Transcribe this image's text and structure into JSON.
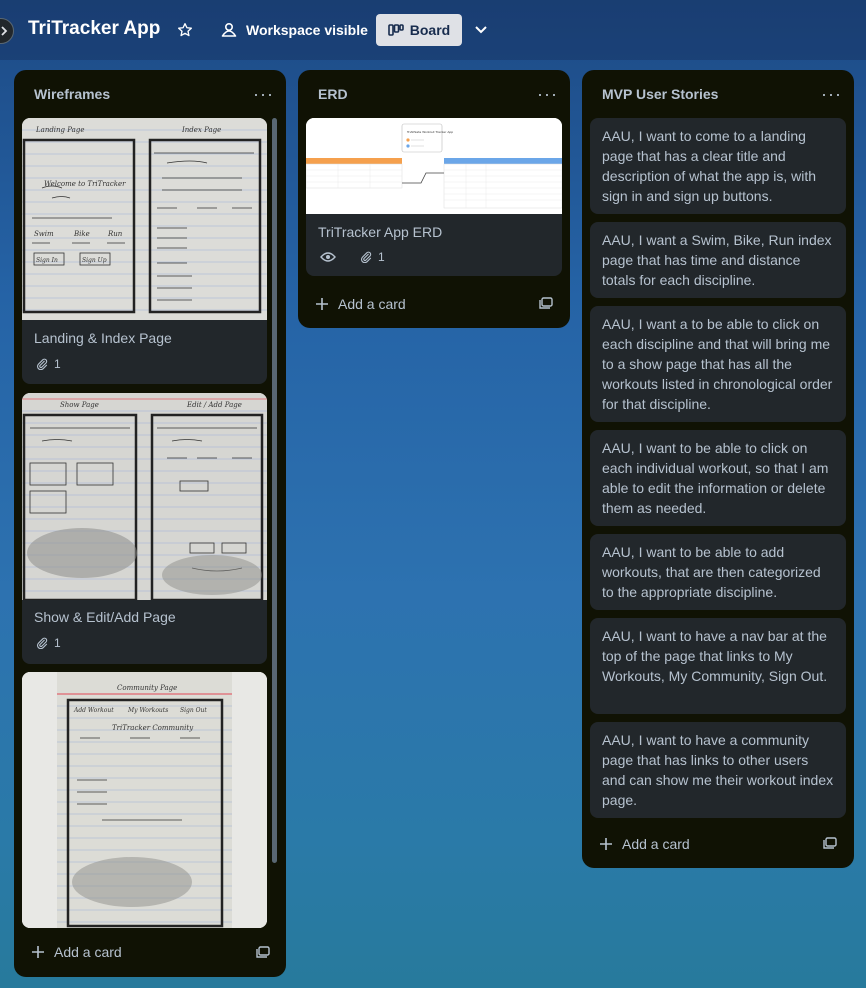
{
  "header": {
    "title": "TriTracker App",
    "workspace_label": "Workspace visible",
    "board_label": "Board"
  },
  "lists": [
    {
      "title": "Wireframes",
      "add_card": "Add a card",
      "cards": [
        {
          "title": "Landing & Index Page",
          "attachments": "1"
        },
        {
          "title": "Show & Edit/Add Page",
          "attachments": "1"
        },
        {
          "title": ""
        }
      ]
    },
    {
      "title": "ERD",
      "add_card": "Add a card",
      "cards": [
        {
          "title": "TriTracker App ERD",
          "attachments": "1"
        }
      ]
    },
    {
      "title": "MVP User Stories",
      "add_card": "Add a card",
      "cards": [
        {
          "text": "AAU, I want to come to a landing page that has a clear title and description of what the app is, with sign in and sign up buttons."
        },
        {
          "text": "AAU, I want a Swim, Bike, Run index page that has time and distance totals for each discipline."
        },
        {
          "text": "AAU, I want a to be able to click on each discipline and that will bring me to a show page that has all the workouts listed in chronological order for that discipline."
        },
        {
          "text": "AAU, I want to be able to click on each individual workout, so that I am able to edit the information or delete them as needed."
        },
        {
          "text": "AAU, I want to be able to add workouts, that are then categorized to the appropriate discipline."
        },
        {
          "text": "AAU, I want to have a nav bar at the top of the page that links to My Workouts, My Community, Sign Out."
        },
        {
          "text": "AAU, I want to have a community page that has links to other users and can show me their workout index page."
        }
      ]
    }
  ],
  "sketches": {
    "landing": {
      "left_title": "Landing Page",
      "right_title": "Index Page",
      "welcome": "Welcome to TriTracker",
      "swim": "Swim",
      "bike": "Bike",
      "run": "Run",
      "sign_in": "Sign In",
      "sign_up": "Sign Up"
    },
    "show": {
      "left_title": "Show Page",
      "right_title": "Edit / Add Page"
    },
    "community": {
      "title": "Community Page",
      "add_workout": "Add Workout",
      "my_workouts": "My Workouts",
      "sign_out": "Sign Out",
      "subtitle": "TriTracker Community"
    }
  },
  "erd": {
    "legend_title": "TriAthlete Workout Tracker App"
  },
  "colors": {
    "accent_orange": "#f5a04d",
    "accent_blue": "#6ba6e8"
  }
}
